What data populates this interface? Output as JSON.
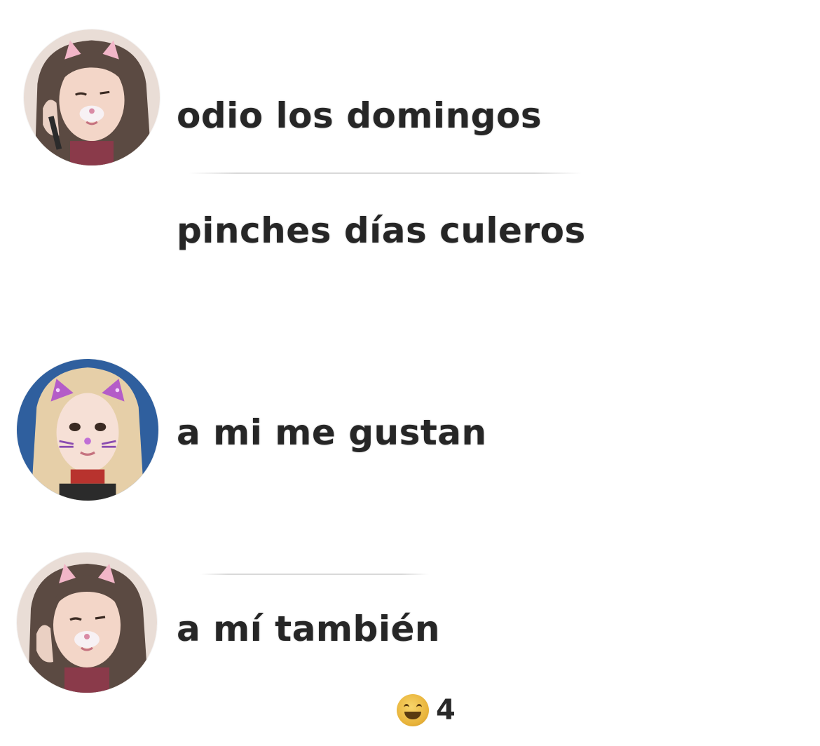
{
  "messages": [
    {
      "sender": "user-a",
      "text": "odio los domingos"
    },
    {
      "sender": "user-a",
      "text": "pinches días culeros"
    },
    {
      "sender": "user-b",
      "text": "a mi me gustan"
    },
    {
      "sender": "user-a",
      "text": "a mí también"
    }
  ],
  "reaction": {
    "icon": "grinning-face-emoji",
    "count": "4"
  },
  "colors": {
    "background": "#ffffff",
    "text": "#262626",
    "divider": "#d9d9d9",
    "emoji": "#e8b33a"
  }
}
